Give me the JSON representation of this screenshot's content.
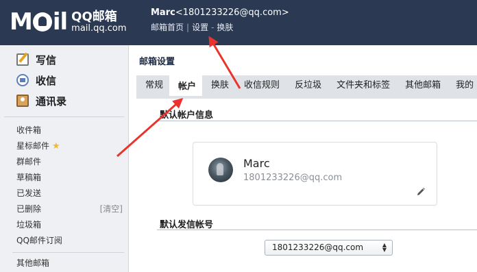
{
  "header": {
    "logo": {
      "brand": "M",
      "brand_rest": "il",
      "product": "QQ邮箱",
      "domain": "mail.qq.com"
    },
    "user": {
      "name": "Marc",
      "email": "<1801233226@qq.com>"
    },
    "links": {
      "home": "邮箱首页",
      "sep1": "|",
      "settings": "设置",
      "sep2": "-",
      "skin": "换肤"
    }
  },
  "sidebar": {
    "quick": [
      {
        "label": "写信",
        "icon": "compose-icon"
      },
      {
        "label": "收信",
        "icon": "inbox-icon"
      },
      {
        "label": "通讯录",
        "icon": "contacts-icon"
      }
    ],
    "folders": [
      {
        "label": "收件箱"
      },
      {
        "label": "星标邮件",
        "star": "★"
      },
      {
        "label": "群邮件"
      },
      {
        "label": "草稿箱"
      },
      {
        "label": "已发送"
      },
      {
        "label": "已删除",
        "action": "[清空]"
      },
      {
        "label": "垃圾箱"
      },
      {
        "label": "QQ邮件订阅"
      }
    ],
    "other": "其他邮箱"
  },
  "main": {
    "title": "邮箱设置",
    "tabs": [
      "常规",
      "帐户",
      "换肤",
      "收信规则",
      "反垃圾",
      "文件夹和标签",
      "其他邮箱",
      "我的"
    ],
    "active_tab": 1,
    "section1": "默认帐户信息",
    "card": {
      "name": "Marc",
      "email": "1801233226@qq.com"
    },
    "section2": "默认发信帐号",
    "sender_select": {
      "value": "1801233226@qq.com"
    }
  },
  "colors": {
    "header_bg": "#2b3a52",
    "arrow": "#e8342d",
    "sidebar_bg": "#eef0f3",
    "tabs_bg": "#dfe3e8"
  }
}
